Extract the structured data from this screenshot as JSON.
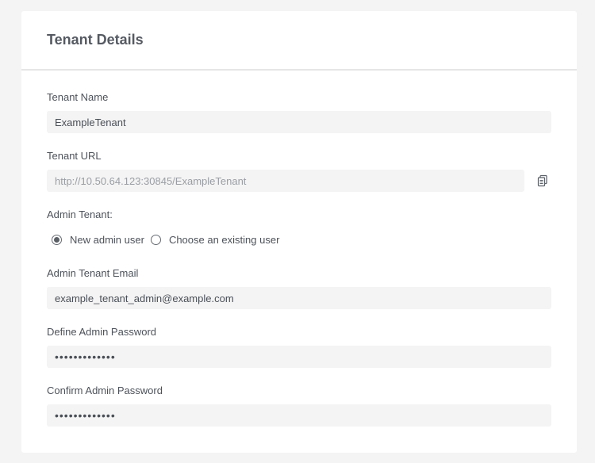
{
  "card": {
    "title": "Tenant Details"
  },
  "fields": {
    "tenant_name": {
      "label": "Tenant Name",
      "value": "ExampleTenant"
    },
    "tenant_url": {
      "label": "Tenant URL",
      "value": "http://10.50.64.123:30845/ExampleTenant",
      "copy_icon": "copy-icon"
    },
    "admin_tenant": {
      "label": "Admin Tenant:",
      "options": [
        {
          "label": "New admin user",
          "selected": true
        },
        {
          "label": "Choose an existing user",
          "selected": false
        }
      ]
    },
    "admin_email": {
      "label": "Admin Tenant Email",
      "value": "example_tenant_admin@example.com"
    },
    "admin_password": {
      "label": "Define Admin Password",
      "value": "•••••••••••••"
    },
    "confirm_password": {
      "label": "Confirm Admin Password",
      "value": "•••••••••••••"
    }
  }
}
